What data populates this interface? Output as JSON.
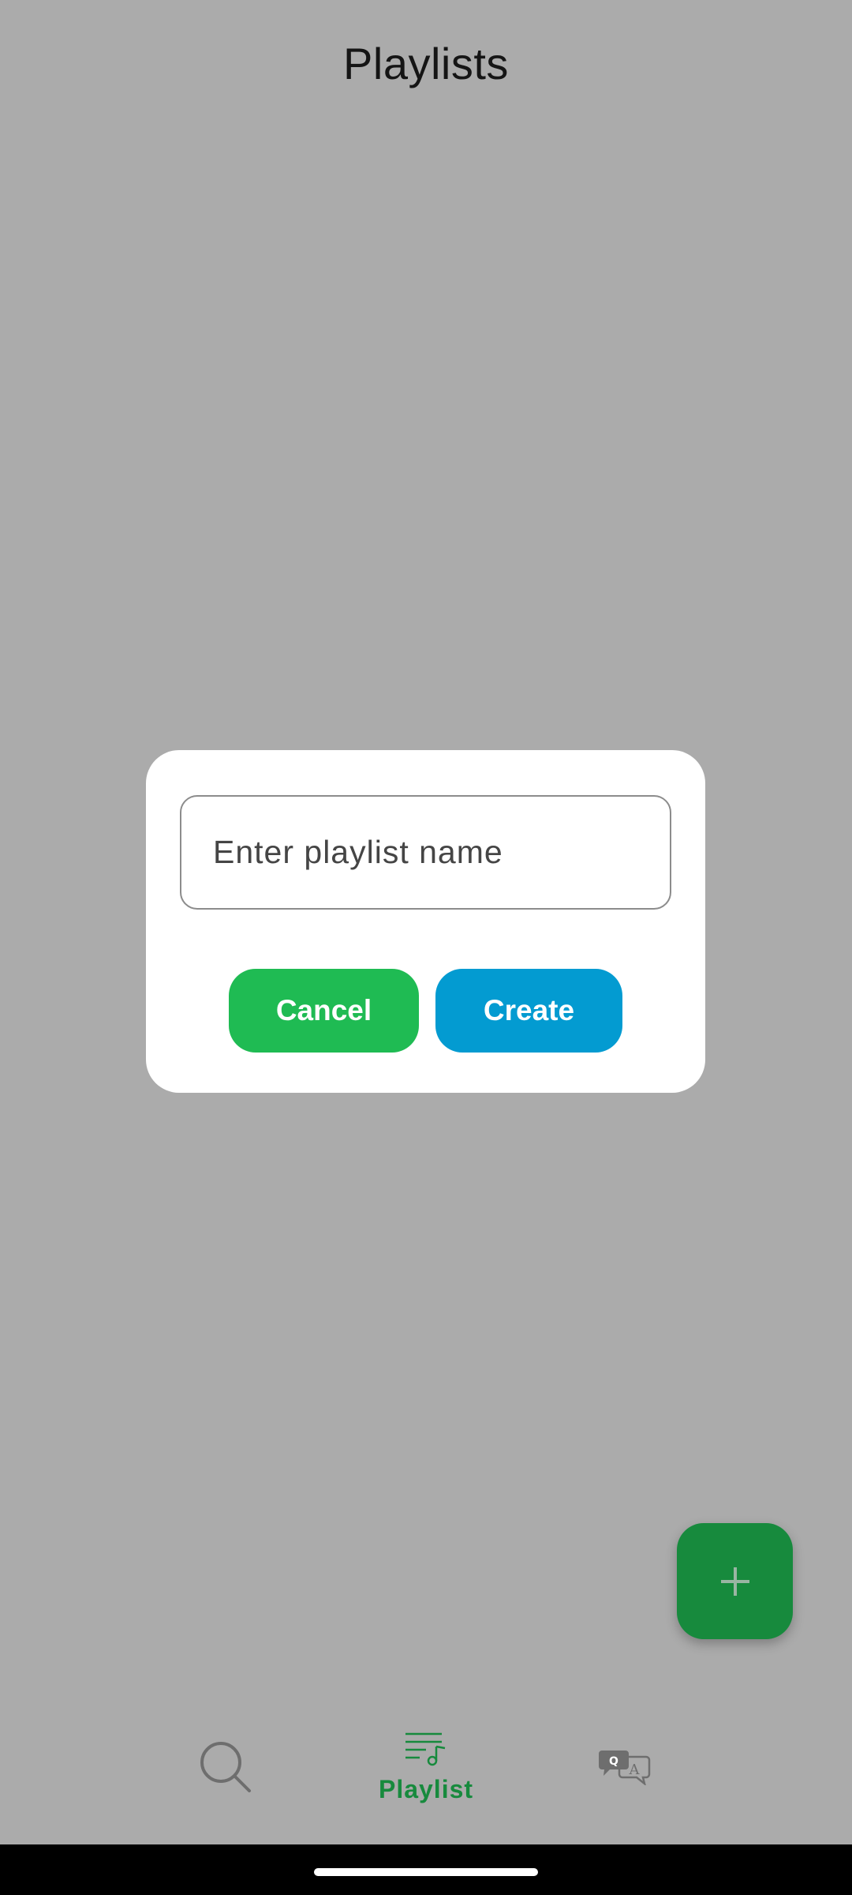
{
  "header": {
    "title": "Playlists"
  },
  "dialog": {
    "input_placeholder": "Enter playlist name",
    "input_value": "",
    "cancel_label": "Cancel",
    "create_label": "Create"
  },
  "fab": {
    "icon": "plus-icon"
  },
  "bottom_nav": {
    "items": [
      {
        "icon": "search-icon",
        "label": "",
        "active": false
      },
      {
        "icon": "playlist-music-icon",
        "label": "Playlist",
        "active": true
      },
      {
        "icon": "qa-chat-icon",
        "label": "",
        "active": false
      }
    ]
  },
  "colors": {
    "background_scrim": "#ababab",
    "cancel_button": "#1fbb53",
    "create_button": "#039bd1",
    "fab": "#178a3d",
    "active_nav": "#178a3d",
    "inactive_icon": "#6e6e6e"
  }
}
